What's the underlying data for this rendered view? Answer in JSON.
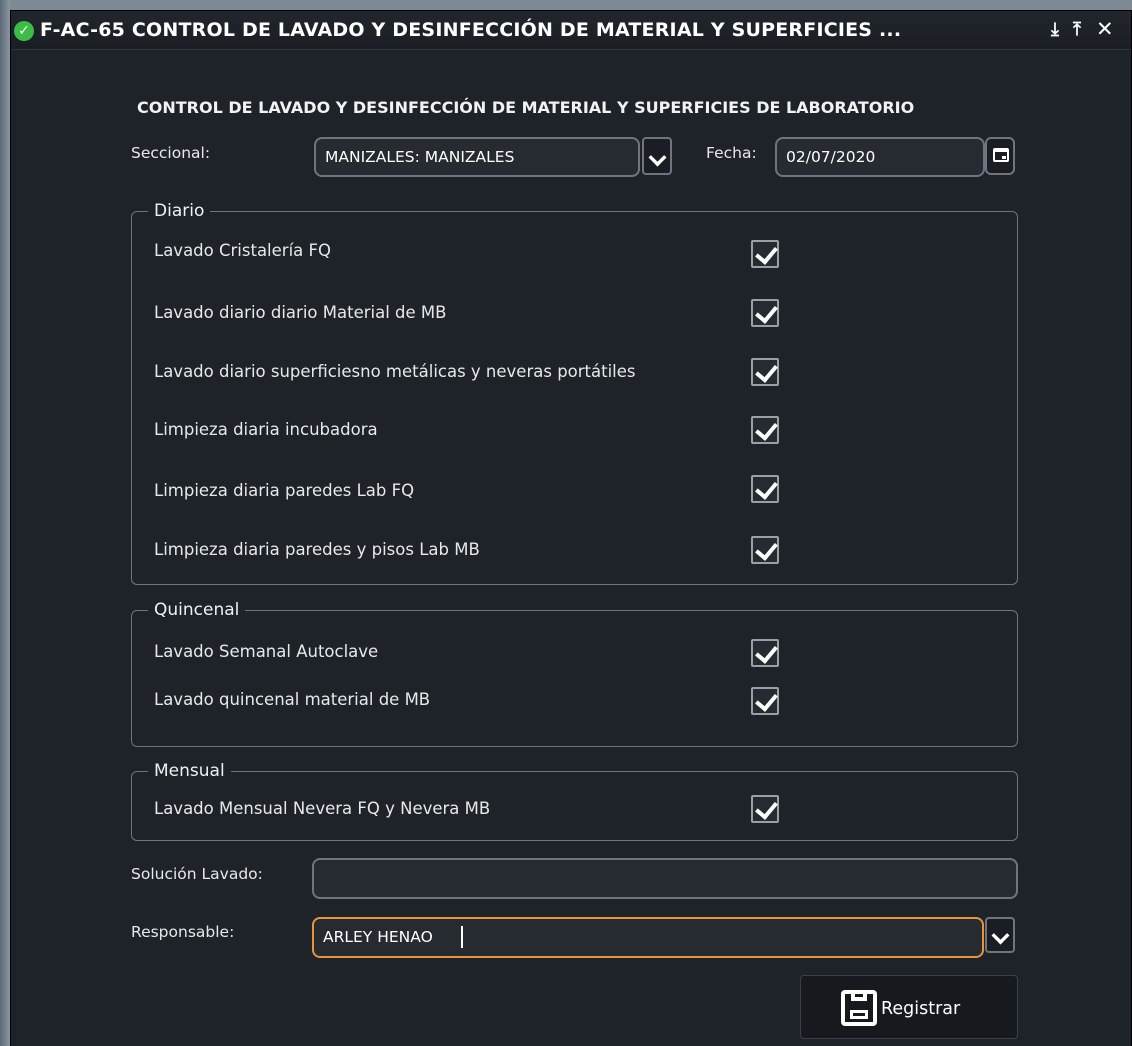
{
  "window": {
    "title": "F-AC-65 CONTROL DE LAVADO Y DESINFECCIÓN DE MATERIAL Y SUPERFICIES ...",
    "status_icon": "check-circle-icon",
    "controls": [
      "download-icon",
      "pin-icon",
      "close-icon"
    ],
    "control_glyphs": {
      "download": "⤓",
      "pin": "⤒",
      "close": "✕"
    }
  },
  "form": {
    "heading": "CONTROL DE LAVADO Y DESINFECCIÓN DE MATERIAL Y SUPERFICIES DE LABORATORIO",
    "seccional": {
      "label": "Seccional:",
      "value": "MANIZALES: MANIZALES"
    },
    "fecha": {
      "label": "Fecha:",
      "value": "02/07/2020"
    },
    "groups": {
      "diario": {
        "title": "Diario",
        "items": [
          {
            "label": "Lavado Cristalería FQ",
            "checked": true
          },
          {
            "label": "Lavado diario diario Material de MB",
            "checked": true
          },
          {
            "label": "Lavado diario superficiesno metálicas y neveras portátiles",
            "checked": true
          },
          {
            "label": "Limpieza diaria incubadora",
            "checked": true
          },
          {
            "label": "Limpieza diaria paredes Lab FQ",
            "checked": true
          },
          {
            "label": "Limpieza diaria paredes y pisos Lab MB",
            "checked": true
          }
        ]
      },
      "quincenal": {
        "title": "Quincenal",
        "items": [
          {
            "label": "Lavado Semanal Autoclave",
            "checked": true
          },
          {
            "label": "Lavado quincenal material de MB",
            "checked": true
          }
        ]
      },
      "mensual": {
        "title": "Mensual",
        "items": [
          {
            "label": "Lavado Mensual Nevera FQ y Nevera MB",
            "checked": true
          }
        ]
      }
    },
    "solucion": {
      "label": "Solución Lavado:",
      "value": ""
    },
    "responsable": {
      "label": "Responsable:",
      "value": "ARLEY HENAO"
    },
    "submit_label": "Registrar"
  },
  "colors": {
    "accent_focus": "#e8953a",
    "background": "#1e232a",
    "success": "#3dbd47"
  }
}
